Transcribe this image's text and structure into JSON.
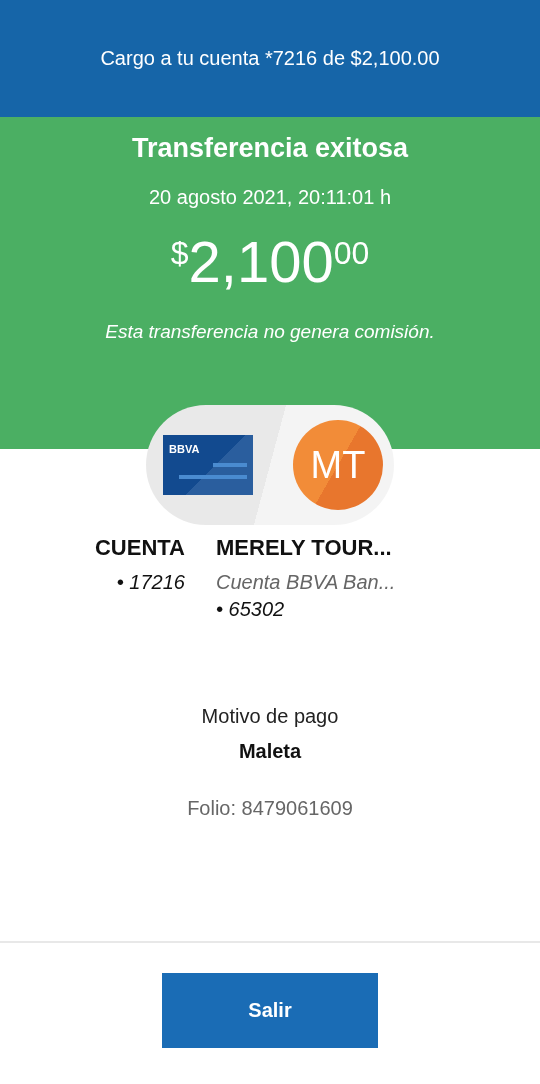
{
  "header": {
    "text": "Cargo a tu cuenta *7216 de $2,100.00"
  },
  "status": {
    "title": "Transferencia exitosa",
    "date": "20 agosto 2021, 20:11:01 h",
    "amount": {
      "currency": "$",
      "whole": "2,100",
      "cents": "00"
    },
    "note": "Esta transferencia no genera comisión."
  },
  "origin": {
    "logo": "BBVA",
    "name": "CUENTA",
    "lines": [
      "• 17216"
    ]
  },
  "destination": {
    "initials": "MT",
    "name": "MERELY TOUR...",
    "lines": [
      "Cuenta BBVA Ban...",
      "• 65302"
    ]
  },
  "details": {
    "label": "Motivo de pago",
    "value": "Maleta",
    "folio": "Folio: 8479061609"
  },
  "button": {
    "label": "Salir"
  }
}
